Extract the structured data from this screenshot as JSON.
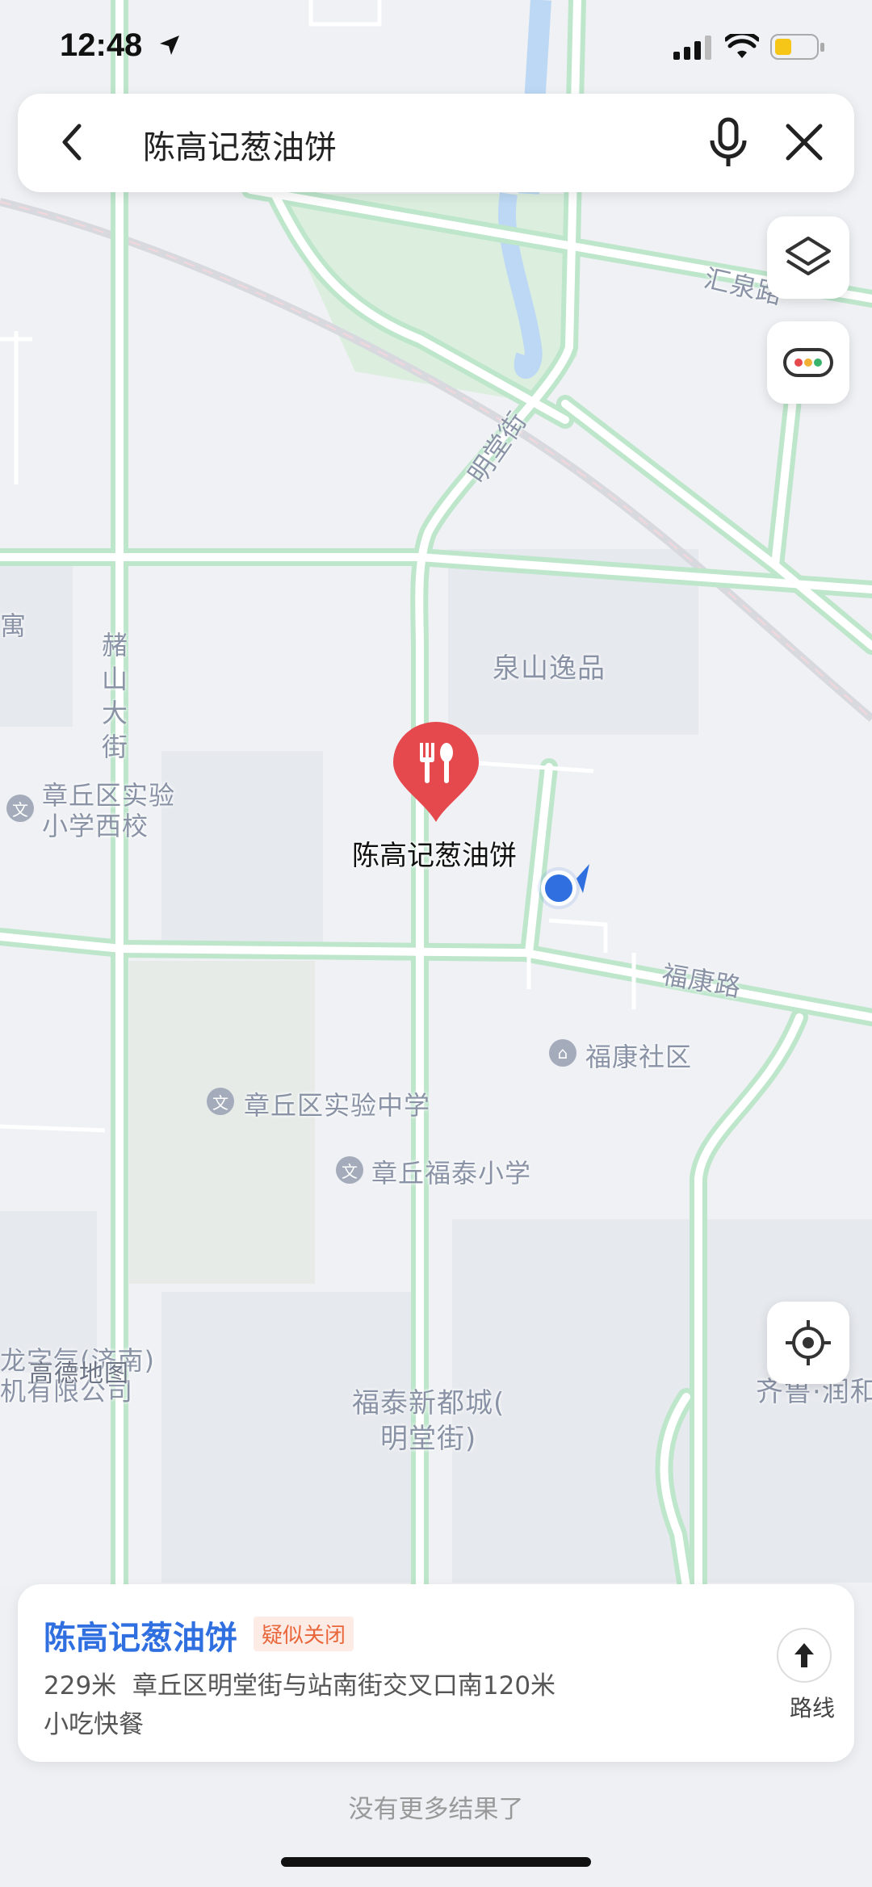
{
  "status_bar": {
    "time": "12:48"
  },
  "search": {
    "query": "陈高记葱油饼"
  },
  "map": {
    "labels": {
      "huiquan_road": "汇泉路",
      "mingtang_street": "明堂街",
      "apartment": "寓",
      "zhushan_street": "赭山大街",
      "quanshan_yipin": "泉山逸品",
      "zhangqiu_primary_west_1": "章丘区实验",
      "zhangqiu_primary_west_2": "小学西校",
      "fukang_road": "福康路",
      "fukang_community": "福康社区",
      "zhangqiu_middle": "章丘区实验中学",
      "futai_primary": "章丘福泰小学",
      "longqi_1": "龙字气(济南)",
      "longqi_2": "机有限公司",
      "watermark": "高德地图",
      "futai_city_1": "福泰新都城(",
      "futai_city_2": "明堂街)",
      "qilu": "齐鲁·润和"
    },
    "pin_label": "陈高记葱油饼",
    "poi_icon_glyph": "文"
  },
  "result": {
    "name": "陈高记葱油饼",
    "status_badge": "疑似关闭",
    "distance": "229米",
    "address": "章丘区明堂街与站南街交叉口南120米",
    "category": "小吃快餐",
    "route_label": "路线"
  },
  "footer": {
    "text": "没有更多结果了"
  },
  "colors": {
    "accent": "#2f6fe0",
    "pin": "#e5484d",
    "road_border": "#b9e3c8",
    "badge_text": "#e8663a"
  }
}
